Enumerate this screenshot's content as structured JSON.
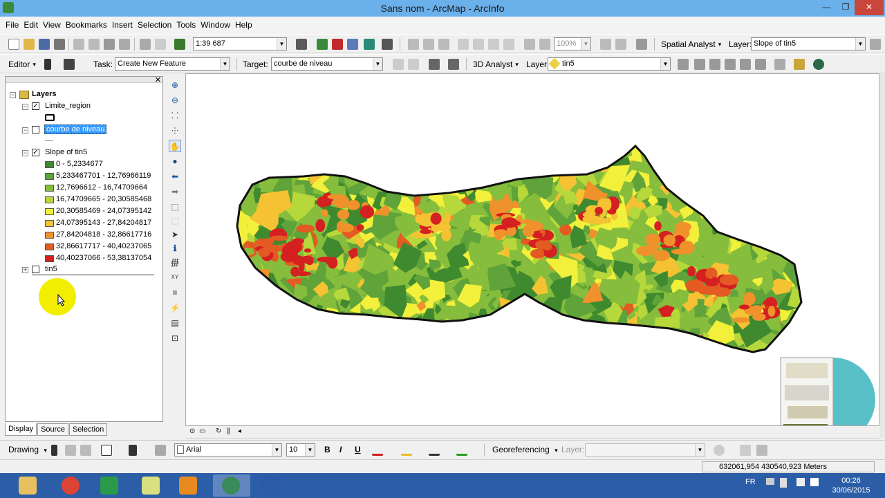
{
  "window": {
    "title": "Sans nom - ArcMap - ArcInfo",
    "minimize": "—",
    "restore": "❐",
    "close": "✕"
  },
  "menu": [
    "File",
    "Edit",
    "View",
    "Bookmarks",
    "Insert",
    "Selection",
    "Tools",
    "Window",
    "Help"
  ],
  "standard_toolbar": {
    "scale": "1:39 687",
    "zoom": "100%",
    "spatial_analyst_label": "Spatial Analyst",
    "layer_label": "Layer:",
    "layer_value": "Slope of tin5"
  },
  "editor_toolbar": {
    "editor_label": "Editor",
    "task_label": "Task:",
    "task_value": "Create New Feature",
    "target_label": "Target:",
    "target_value": "courbe de niveau",
    "analyst3d_label": "3D Analyst",
    "layer_label": "Layer:",
    "layer_value": "tin5"
  },
  "toc": {
    "root": "Layers",
    "layers": [
      {
        "name": "Limite_region",
        "checked": true,
        "expanded": true
      },
      {
        "name": "courbe de niveau",
        "checked": false,
        "expanded": true,
        "selected": true
      },
      {
        "name": "Slope of tin5",
        "checked": true,
        "expanded": true
      },
      {
        "name": "tin5",
        "checked": false,
        "expanded": false
      }
    ],
    "legend": [
      {
        "label": "0 - 5,2334677",
        "color": "#3f8a2e"
      },
      {
        "label": "5,233467701 - 12,76966119",
        "color": "#5fa33a"
      },
      {
        "label": "12,7696612 - 16,74709664",
        "color": "#86bd3c"
      },
      {
        "label": "16,74709665 - 20,30585468",
        "color": "#b6d83a"
      },
      {
        "label": "20,30585469 - 24,07395142",
        "color": "#f2f03a"
      },
      {
        "label": "24,07395143 - 27,84204817",
        "color": "#f5c233"
      },
      {
        "label": "27,84204818 - 32,86617716",
        "color": "#f0922c"
      },
      {
        "label": "32,86617717 - 40,40237065",
        "color": "#e35a22"
      },
      {
        "label": "40,40237066 - 53,38137054",
        "color": "#d42020"
      }
    ],
    "tabs": [
      "Display",
      "Source",
      "Selection"
    ]
  },
  "drawing_toolbar": {
    "drawing_label": "Drawing",
    "font": "Arial",
    "size": "10",
    "bold": "B",
    "italic": "I",
    "underline": "U",
    "georef_label": "Georeferencing",
    "layer_label": "Layer:"
  },
  "status": {
    "coords": "632061,954  430540,923 Meters"
  },
  "taskbar": {
    "lang": "FR",
    "time": "00:26",
    "date": "30/06/2015"
  },
  "icons": {
    "toc_close": "✕",
    "dropdown_arrow": "▼",
    "caret": "▾",
    "expanded": "−",
    "collapsed": "+",
    "check": "✓",
    "tools": [
      "⊕",
      "⊖",
      "⸬",
      "⸭",
      "✋",
      "●",
      "⬅",
      "➡",
      "⬚",
      "⬚",
      "➤",
      "ℹ",
      "∰",
      "XY",
      "≡",
      "⚡",
      "▤",
      "⊡"
    ],
    "map_footer": [
      "⊙",
      "▭",
      "↻",
      "∥",
      "◂"
    ]
  },
  "colors": {
    "titlebar": "#6ab0ea",
    "taskbar": "#2c5ea8",
    "selection": "#3399ff"
  }
}
